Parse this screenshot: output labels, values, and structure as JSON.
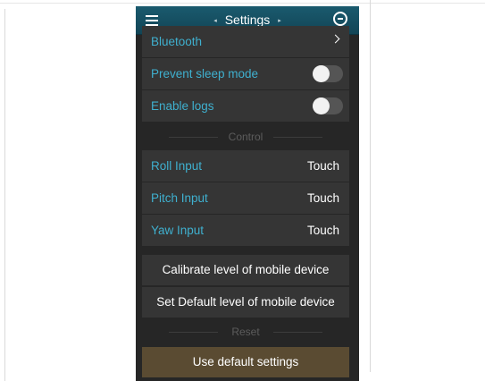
{
  "header": {
    "title": "Settings",
    "prev_arrow": "◂",
    "next_arrow": "▸",
    "menu_icon": "hamburger-menu-icon",
    "right_icon": "minus-circle-icon"
  },
  "settings_rows": [
    {
      "label": "Bluetooth",
      "type": "chevron"
    },
    {
      "label": "Prevent sleep mode",
      "type": "toggle",
      "on": false
    },
    {
      "label": "Enable logs",
      "type": "toggle",
      "on": false
    }
  ],
  "control": {
    "section_label": "Control",
    "rows": [
      {
        "label": "Roll Input",
        "value": "Touch"
      },
      {
        "label": "Pitch Input",
        "value": "Touch"
      },
      {
        "label": "Yaw Input",
        "value": "Touch"
      }
    ],
    "calibrate_label": "Calibrate level of mobile device",
    "set_default_label": "Set Default level of mobile device"
  },
  "reset": {
    "section_label": "Reset",
    "button_label": "Use default settings"
  },
  "colors": {
    "accent": "#3fb0cf",
    "topbar": "#124556",
    "background": "#262626",
    "row": "#353535",
    "reset_button": "#5a4b32"
  }
}
